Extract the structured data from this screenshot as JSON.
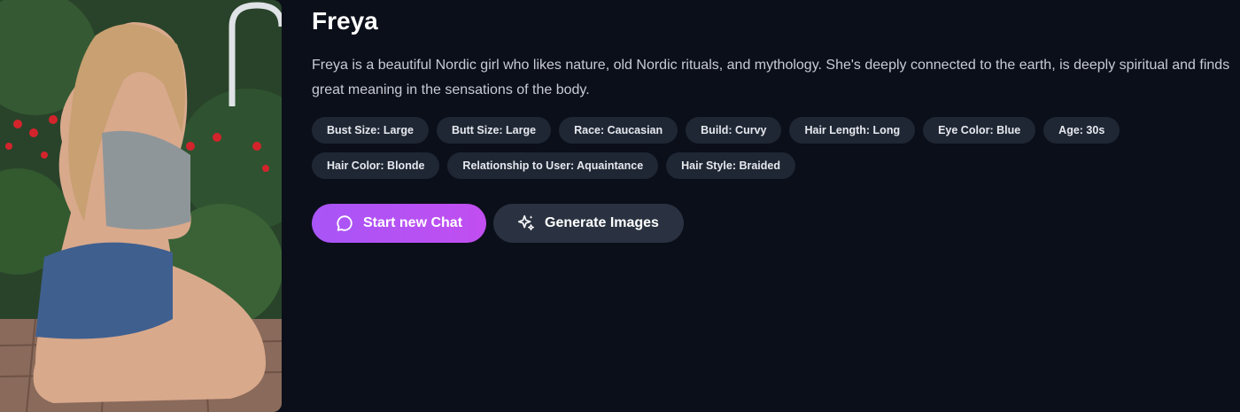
{
  "character": {
    "name": "Freya",
    "description": "Freya is a beautiful Nordic girl who likes nature, old Nordic rituals, and mythology. She's deeply connected to the earth, is deeply spiritual and finds great meaning in the sensations of the body."
  },
  "tags": [
    "Bust Size: Large",
    "Butt Size: Large",
    "Race: Caucasian",
    "Build: Curvy",
    "Hair Length: Long",
    "Eye Color: Blue",
    "Age: 30s",
    "Hair Color: Blonde",
    "Relationship to User: Aquaintance",
    "Hair Style: Braided"
  ],
  "actions": {
    "start_chat_label": "Start new Chat",
    "start_chat_icon": "chat-bubble-icon",
    "generate_images_label": "Generate Images",
    "generate_images_icon": "sparkles-icon"
  },
  "colors": {
    "background": "#0b0f1a",
    "accent": "#a855f7",
    "tag_bg": "#1f2734",
    "secondary_btn": "#2a3241"
  }
}
